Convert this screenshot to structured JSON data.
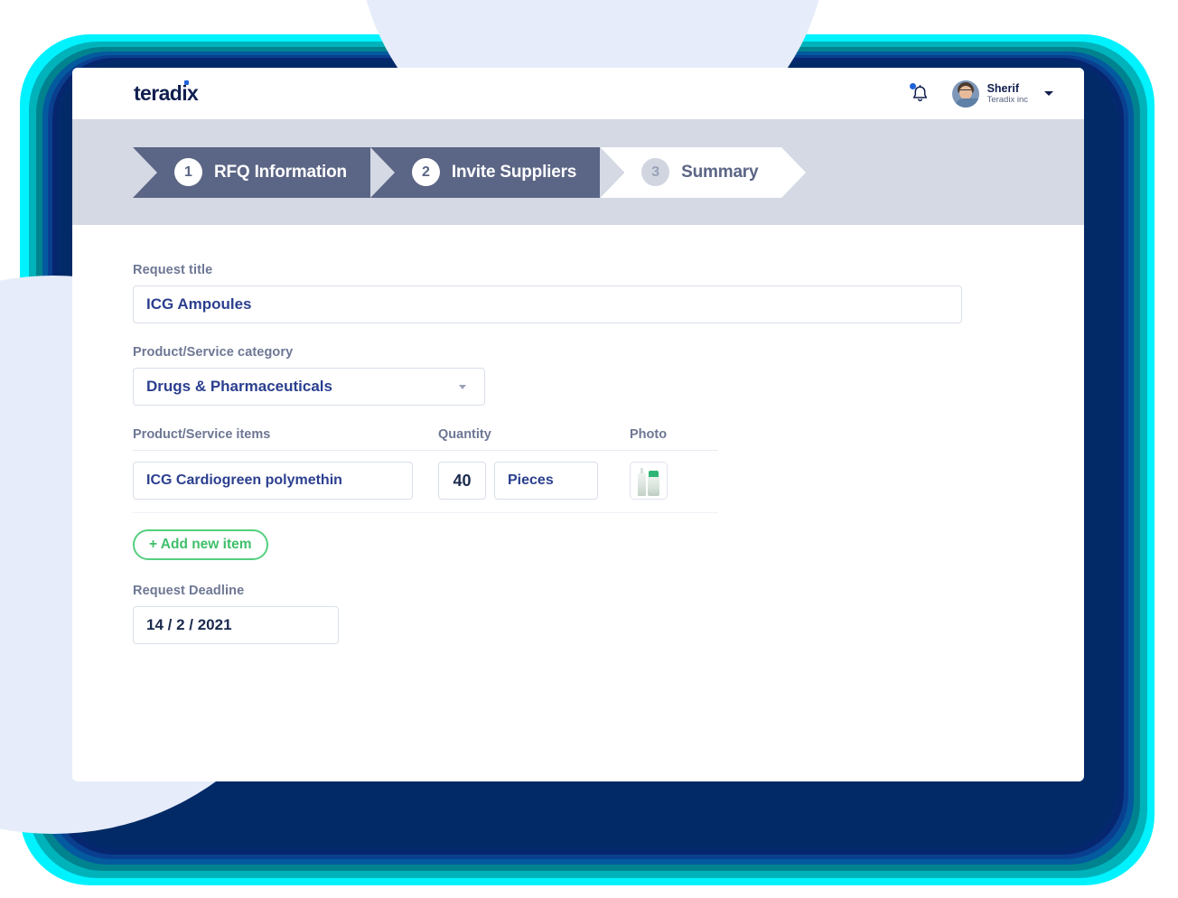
{
  "brand": {
    "logo_text": "teradix",
    "accent_color": "#1f62d8",
    "logo_color": "#101f4f"
  },
  "header": {
    "notification_icon": "bell-icon",
    "has_unread": true,
    "user": {
      "name": "Sherif",
      "company": "Teradix inc"
    },
    "dropdown_icon": "chevron-down-icon"
  },
  "stepper": {
    "steps": [
      {
        "number": "1",
        "label": "RFQ Information",
        "state": "active"
      },
      {
        "number": "2",
        "label": "Invite Suppliers",
        "state": "active"
      },
      {
        "number": "3",
        "label": "Summary",
        "state": "inactive"
      }
    ],
    "active_color": "#5b6585",
    "band_color": "#d4d9e4"
  },
  "form": {
    "request_title": {
      "label": "Request title",
      "value": "ICG Ampoules",
      "placeholder": "Request title"
    },
    "category": {
      "label": "Product/Service category",
      "value": "Drugs & Pharmaceuticals",
      "dropdown_icon": "chevron-down-icon"
    },
    "items": {
      "columns": [
        "Product/Service items",
        "Quantity",
        "Photo"
      ],
      "rows": [
        {
          "name": "ICG Cardiogreen polymethin",
          "quantity": "40",
          "unit": "Pieces",
          "unit_dropdown_icon": "chevron-down-icon",
          "photo": "medicine-ampoule-thumbnail"
        }
      ],
      "add_button": {
        "label": "+ Add new item",
        "color": "#3fbf6a"
      }
    },
    "deadline": {
      "label": "Request Deadline",
      "value": "14 / 2 / 2021"
    }
  },
  "decor": {
    "glow_colors": [
      "#00f2ff",
      "#00b3bb",
      "#00838f",
      "#045a9e",
      "#0a3f8f",
      "#06266f",
      "#032a6b",
      "#022a66"
    ],
    "circle_color": "#e6ecf9"
  }
}
